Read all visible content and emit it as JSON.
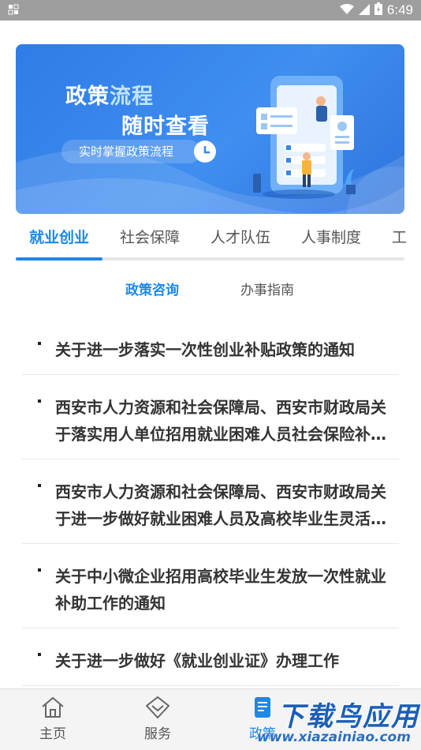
{
  "status_bar": {
    "time": "6:49"
  },
  "banner": {
    "title_part1": "政策",
    "title_part2": "流程",
    "title_line2": "随时查看",
    "pill": "实时掌握政策流程"
  },
  "category_tabs": [
    {
      "label": "就业创业",
      "active": true
    },
    {
      "label": "社会保障",
      "active": false
    },
    {
      "label": "人才队伍",
      "active": false
    },
    {
      "label": "人事制度",
      "active": false
    },
    {
      "label": "工",
      "active": false
    }
  ],
  "sub_tabs": [
    {
      "label": "政策咨询",
      "active": true
    },
    {
      "label": "办事指南",
      "active": false
    }
  ],
  "policies": [
    "关于进一步落实一次性创业补贴政策的通知",
    "西安市人力资源和社会保障局、西安市财政局关于落实用人单位招用就业困难人员社会保险补贴政策的通知",
    "西安市人力资源和社会保障局、西安市财政局关于进一步做好就业困难人员及高校毕业生灵活就业社会保险补贴工作的通知",
    "关于中小微企业招用高校毕业生发放一次性就业补助工作的通知",
    "关于进一步做好《就业创业证》办理工作"
  ],
  "bottom_nav": [
    {
      "label": "主页",
      "icon": "home-icon",
      "active": false
    },
    {
      "label": "服务",
      "icon": "service-icon",
      "active": false
    },
    {
      "label": "政策",
      "icon": "policy-icon",
      "active": true
    }
  ],
  "watermark": {
    "title": "下载鸟应用",
    "url": "www.xiazainiao.com"
  },
  "colors": {
    "accent": "#1e88e5",
    "banner": "#3a86ee",
    "status_bar": "#9e9e9e"
  }
}
